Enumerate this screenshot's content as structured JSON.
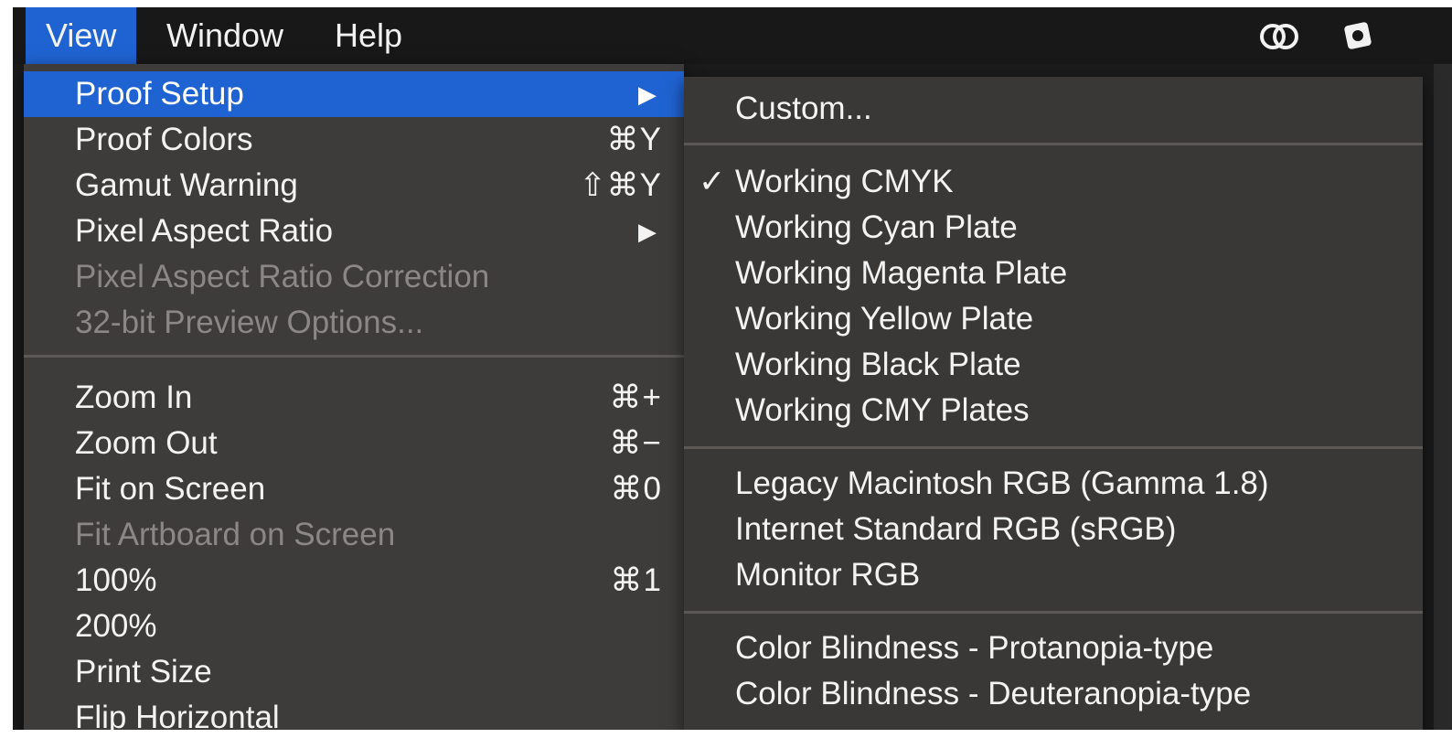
{
  "menubar": {
    "items": [
      {
        "label": "View",
        "active": true
      },
      {
        "label": "Window",
        "active": false
      },
      {
        "label": "Help",
        "active": false
      }
    ],
    "right_icons": [
      "creative-cloud-icon",
      "sketch-app-icon"
    ]
  },
  "view_menu": {
    "groups": [
      [
        {
          "label": "Proof Setup",
          "submenu": true,
          "highlighted": true,
          "disabled": false,
          "shortcut": ""
        },
        {
          "label": "Proof Colors",
          "shortcut": "⌘Y",
          "disabled": false
        },
        {
          "label": "Gamut Warning",
          "shortcut": "⇧⌘Y",
          "disabled": false
        },
        {
          "label": "Pixel Aspect Ratio",
          "submenu": true,
          "disabled": false,
          "shortcut": ""
        },
        {
          "label": "Pixel Aspect Ratio Correction",
          "disabled": true,
          "shortcut": ""
        },
        {
          "label": "32-bit Preview Options...",
          "disabled": true,
          "shortcut": ""
        }
      ],
      [
        {
          "label": "Zoom In",
          "shortcut": "⌘+",
          "disabled": false
        },
        {
          "label": "Zoom Out",
          "shortcut": "⌘−",
          "disabled": false
        },
        {
          "label": "Fit on Screen",
          "shortcut": "⌘0",
          "disabled": false
        },
        {
          "label": "Fit Artboard on Screen",
          "disabled": true,
          "shortcut": ""
        },
        {
          "label": "100%",
          "shortcut": "⌘1",
          "disabled": false
        },
        {
          "label": "200%",
          "disabled": false,
          "shortcut": ""
        },
        {
          "label": "Print Size",
          "disabled": false,
          "shortcut": ""
        },
        {
          "label": "Flip Horizontal",
          "disabled": false,
          "shortcut": ""
        }
      ]
    ]
  },
  "proof_setup_submenu": {
    "groups": [
      [
        {
          "label": "Custom...",
          "checked": false
        }
      ],
      [
        {
          "label": "Working CMYK",
          "checked": true
        },
        {
          "label": "Working Cyan Plate",
          "checked": false
        },
        {
          "label": "Working Magenta Plate",
          "checked": false
        },
        {
          "label": "Working Yellow Plate",
          "checked": false
        },
        {
          "label": "Working Black Plate",
          "checked": false
        },
        {
          "label": "Working CMY Plates",
          "checked": false
        }
      ],
      [
        {
          "label": "Legacy Macintosh RGB (Gamma 1.8)",
          "checked": false
        },
        {
          "label": "Internet Standard RGB (sRGB)",
          "checked": false
        },
        {
          "label": "Monitor RGB",
          "checked": false
        }
      ],
      [
        {
          "label": "Color Blindness - Protanopia-type",
          "checked": false
        },
        {
          "label": "Color Blindness - Deuteranopia-type",
          "checked": false
        }
      ]
    ],
    "check_glyph": "✓"
  },
  "colors": {
    "highlight": "#1f63d2",
    "menu_bg": "#3e3c3b",
    "text": "#f3f3f3",
    "disabled_text": "#8b8784"
  }
}
